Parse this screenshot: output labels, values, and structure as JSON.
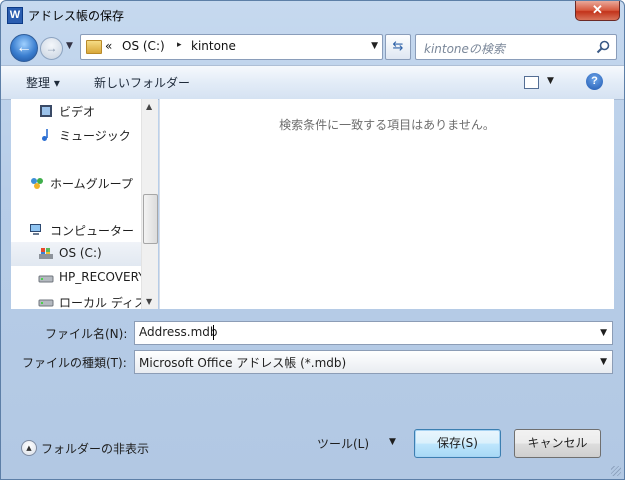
{
  "window": {
    "title": "アドレス帳の保存",
    "app_icon_letter": "W",
    "close_glyph": "✕"
  },
  "address": {
    "overflow": "«",
    "crumbs": [
      "OS (C:)",
      "kintone"
    ],
    "separator": "▸"
  },
  "search": {
    "placeholder": "kintoneの検索"
  },
  "toolbar": {
    "organize_label": "整理 ▾",
    "new_folder_label": "新しいフォルダー",
    "help_glyph": "?"
  },
  "nav_pane": {
    "items": [
      {
        "label": "ビデオ",
        "icon": "video-icon"
      },
      {
        "label": "ミュージック",
        "icon": "music-icon"
      },
      {
        "label": "ホームグループ",
        "icon": "homegroup-icon"
      },
      {
        "label": "コンピューター",
        "icon": "computer-icon"
      },
      {
        "label": "OS (C:)",
        "icon": "drive-icon",
        "selected": true
      },
      {
        "label": "HP_RECOVERY",
        "icon": "drive-icon"
      },
      {
        "label": "ローカル ディスク",
        "icon": "drive-icon"
      }
    ]
  },
  "content": {
    "empty_message": "検索条件に一致する項目はありません。"
  },
  "form": {
    "filename_label": "ファイル名(N):",
    "filename_value": "Address.mdb",
    "filetype_label": "ファイルの種類(T):",
    "filetype_value": "Microsoft Office アドレス帳 (*.mdb)"
  },
  "footer": {
    "hide_folders_label": "フォルダーの非表示",
    "tools_label": "ツール(L)",
    "save_label": "保存(S)",
    "cancel_label": "キャンセル"
  }
}
